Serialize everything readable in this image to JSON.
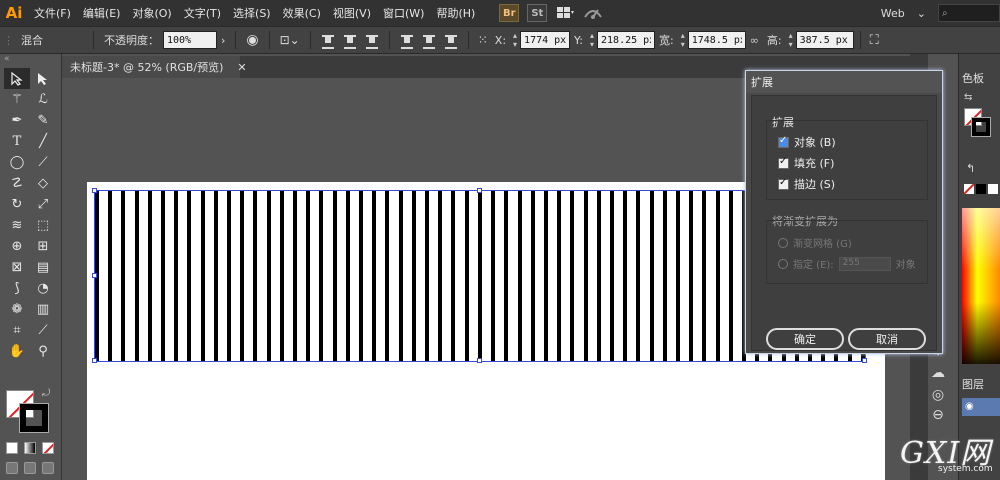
{
  "app": {
    "logo": "Ai"
  },
  "menu": {
    "items": [
      "文件(F)",
      "编辑(E)",
      "对象(O)",
      "文字(T)",
      "选择(S)",
      "效果(C)",
      "视图(V)",
      "窗口(W)",
      "帮助(H)"
    ],
    "bridge_icon": "Br",
    "stock_icon": "St",
    "workspace": "Web",
    "search_placeholder": ""
  },
  "control_bar": {
    "mode_label": "混合",
    "opacity_label": "不透明度：",
    "opacity_value": "100%",
    "x_label": "X:",
    "x_value": "1774 px",
    "y_label": "Y:",
    "y_value": "218.25 px",
    "width_label": "宽:",
    "width_value": "1748.5 px",
    "height_label": "高:",
    "height_value": "387.5 px"
  },
  "document": {
    "tab_title": "未标题-3* @ 52% (RGB/预览)",
    "close_glyph": "✕",
    "stripe_count": 59
  },
  "dialog": {
    "title": "扩展",
    "expand_group_label": "扩展",
    "options": [
      {
        "label": "对象 (B)",
        "checked": true
      },
      {
        "label": "填充 (F)",
        "checked": true
      },
      {
        "label": "描边 (S)",
        "checked": true
      }
    ],
    "gradient_group_label": "将渐变扩展为",
    "gradient_mesh_label": "渐变网格 (G)",
    "specify_label": "指定 (E):",
    "specify_value": "255",
    "specify_unit": "对象",
    "ok_label": "确定",
    "cancel_label": "取消"
  },
  "right_panel": {
    "swatches_tab": "色板",
    "layers_tab": "图层"
  },
  "watermark": {
    "logo": "GXI网",
    "site": "system.com"
  },
  "colors": {
    "accent": "#ff9a00",
    "selection": "#3a4ad8",
    "checkbox_blue": "#4a8ae8"
  }
}
